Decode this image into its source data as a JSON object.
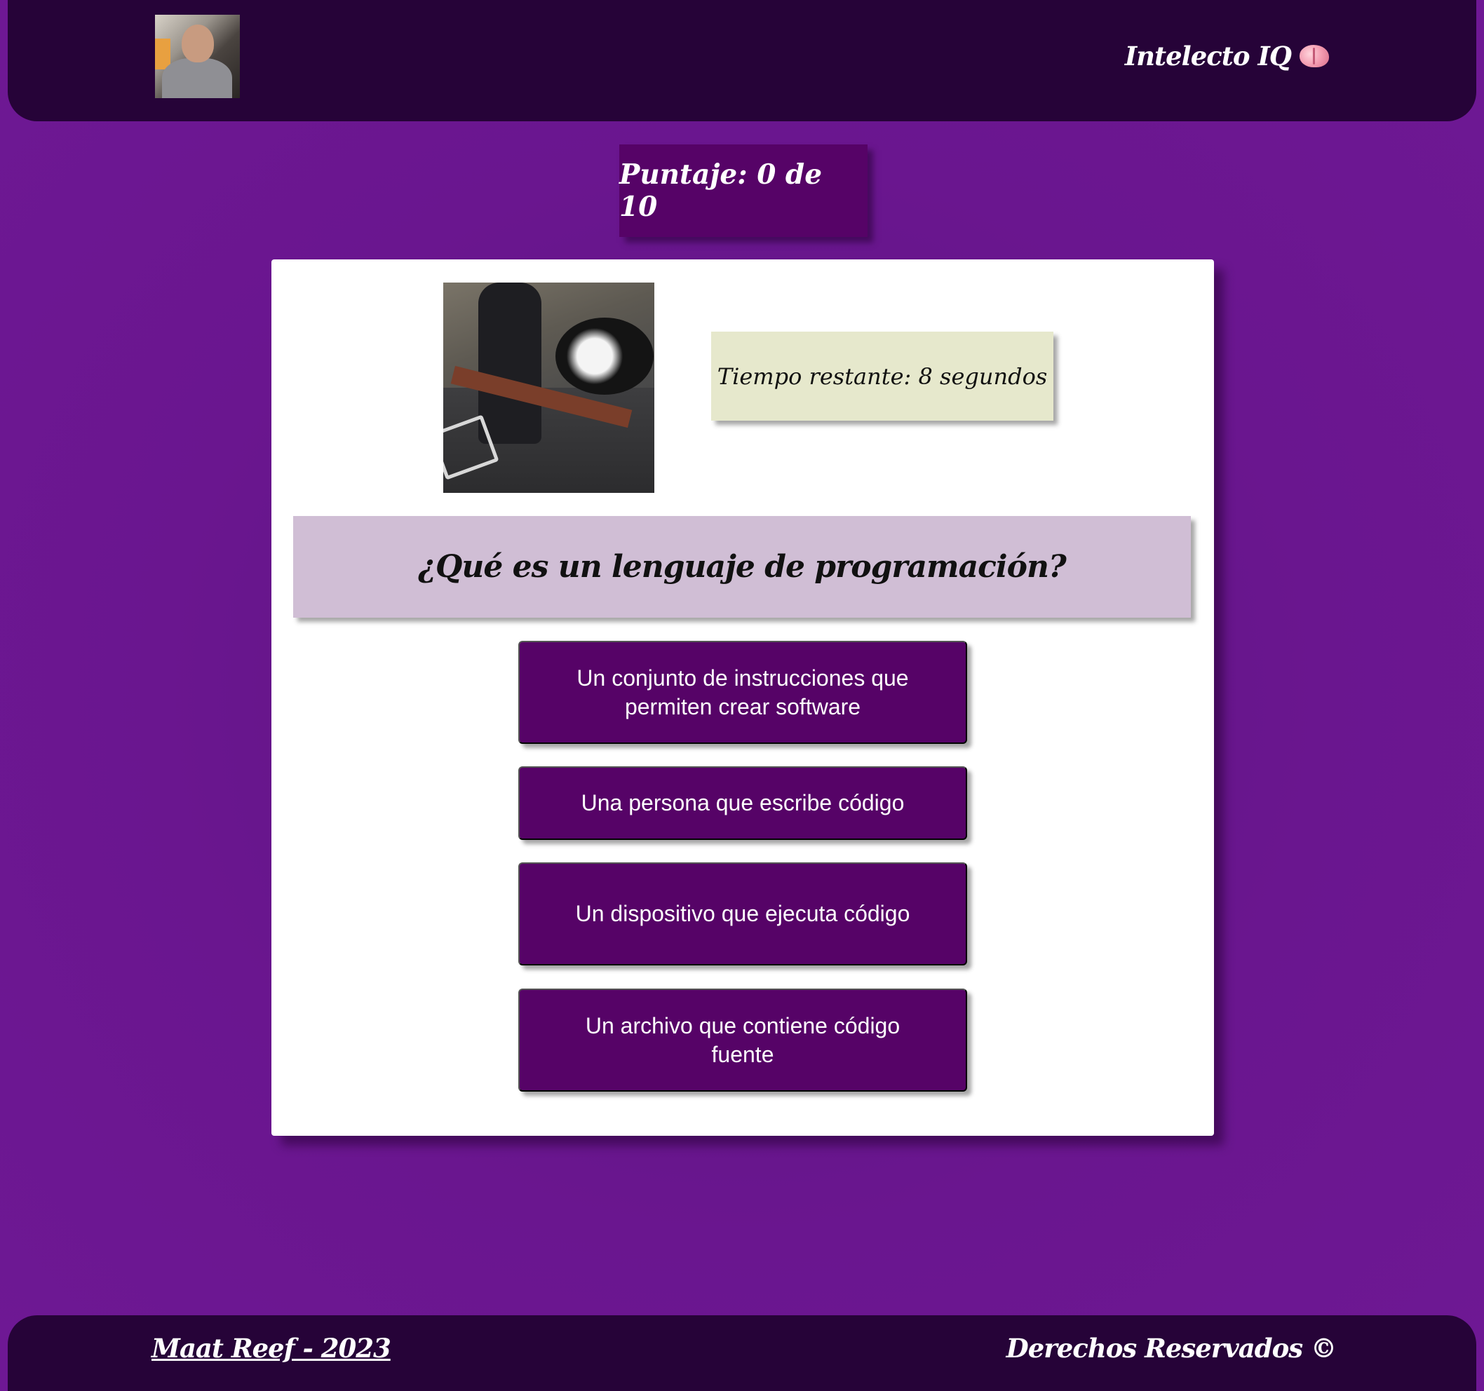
{
  "header": {
    "brand": "Intelecto IQ",
    "brand_icon": "brain-icon"
  },
  "score": {
    "text": "Puntaje: 0 de 10"
  },
  "quiz": {
    "timer_text": "Tiempo restante: 8 segundos",
    "question": "¿Qué es un lenguaje de programación?",
    "answers": [
      "Un conjunto de instrucciones que permiten crear software",
      "Una persona que escribe código",
      "Un dispositivo que ejecuta código",
      "Un archivo que contiene código fuente"
    ]
  },
  "footer": {
    "left_text": "Maat Reef - 2023",
    "right_text": "Derechos Reservados ©"
  },
  "colors": {
    "background": "#6a168f",
    "header_footer": "#260338",
    "answer_button": "#560367",
    "timer_bg": "#e6e8cc",
    "question_bg": "#d0bed5"
  }
}
